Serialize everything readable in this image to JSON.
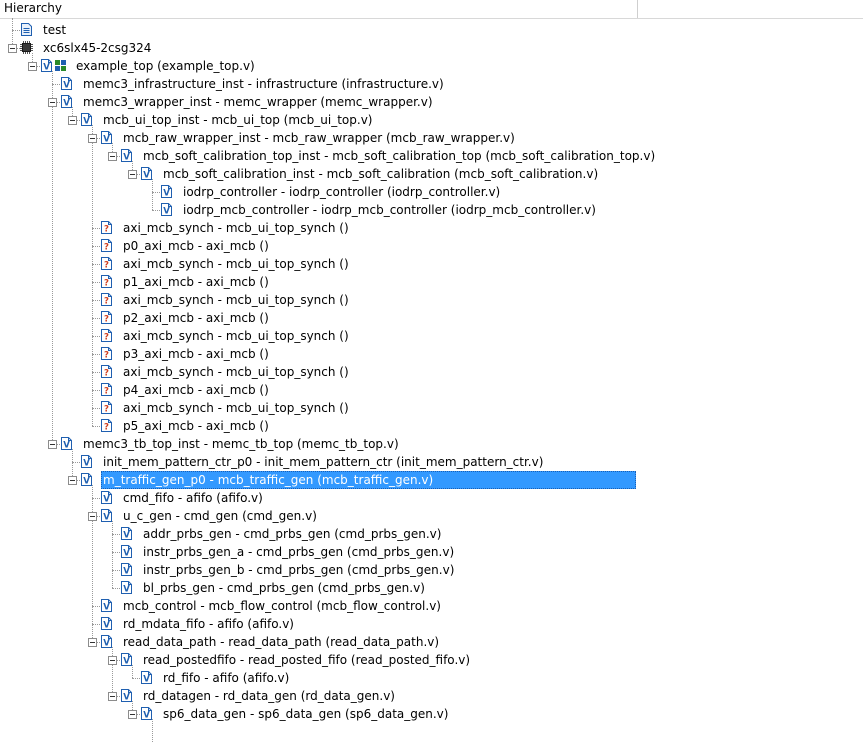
{
  "panel": {
    "title": "Hierarchy"
  },
  "colors": {
    "selection": "#3399ff",
    "verilog_icon": "#1f5fb0",
    "unknown_icon": "#d04020"
  },
  "tree": [
    {
      "label": "test",
      "depth": 0,
      "icon": "text-file-icon",
      "expanded": false,
      "has_children": false
    },
    {
      "label": "xc6slx45-2csg324",
      "depth": 0,
      "icon": "chip-icon",
      "expanded": true,
      "has_children": true
    },
    {
      "label": "example_top (example_top.v)",
      "depth": 1,
      "icon": "verilog-top-module-icon",
      "expanded": true,
      "has_children": true
    },
    {
      "label": "memc3_infrastructure_inst - infrastructure (infrastructure.v)",
      "depth": 2,
      "icon": "verilog-file-icon",
      "expanded": false,
      "has_children": false
    },
    {
      "label": "memc3_wrapper_inst - memc_wrapper (memc_wrapper.v)",
      "depth": 2,
      "icon": "verilog-file-icon",
      "expanded": true,
      "has_children": true
    },
    {
      "label": "mcb_ui_top_inst - mcb_ui_top (mcb_ui_top.v)",
      "depth": 3,
      "icon": "verilog-file-icon",
      "expanded": true,
      "has_children": true
    },
    {
      "label": "mcb_raw_wrapper_inst - mcb_raw_wrapper (mcb_raw_wrapper.v)",
      "depth": 4,
      "icon": "verilog-file-icon",
      "expanded": true,
      "has_children": true
    },
    {
      "label": "mcb_soft_calibration_top_inst - mcb_soft_calibration_top (mcb_soft_calibration_top.v)",
      "depth": 5,
      "icon": "verilog-file-icon",
      "expanded": true,
      "has_children": true
    },
    {
      "label": "mcb_soft_calibration_inst - mcb_soft_calibration (mcb_soft_calibration.v)",
      "depth": 6,
      "icon": "verilog-file-icon",
      "expanded": true,
      "has_children": true
    },
    {
      "label": "iodrp_controller - iodrp_controller (iodrp_controller.v)",
      "depth": 7,
      "icon": "verilog-file-icon",
      "expanded": false,
      "has_children": false
    },
    {
      "label": "iodrp_mcb_controller - iodrp_mcb_controller (iodrp_mcb_controller.v)",
      "depth": 7,
      "icon": "verilog-file-icon",
      "expanded": false,
      "has_children": false
    },
    {
      "label": "axi_mcb_synch - mcb_ui_top_synch ()",
      "depth": 4,
      "icon": "unknown-file-icon",
      "expanded": false,
      "has_children": false
    },
    {
      "label": "p0_axi_mcb - axi_mcb ()",
      "depth": 4,
      "icon": "unknown-file-icon",
      "expanded": false,
      "has_children": false
    },
    {
      "label": "axi_mcb_synch - mcb_ui_top_synch ()",
      "depth": 4,
      "icon": "unknown-file-icon",
      "expanded": false,
      "has_children": false
    },
    {
      "label": "p1_axi_mcb - axi_mcb ()",
      "depth": 4,
      "icon": "unknown-file-icon",
      "expanded": false,
      "has_children": false
    },
    {
      "label": "axi_mcb_synch - mcb_ui_top_synch ()",
      "depth": 4,
      "icon": "unknown-file-icon",
      "expanded": false,
      "has_children": false
    },
    {
      "label": "p2_axi_mcb - axi_mcb ()",
      "depth": 4,
      "icon": "unknown-file-icon",
      "expanded": false,
      "has_children": false
    },
    {
      "label": "axi_mcb_synch - mcb_ui_top_synch ()",
      "depth": 4,
      "icon": "unknown-file-icon",
      "expanded": false,
      "has_children": false
    },
    {
      "label": "p3_axi_mcb - axi_mcb ()",
      "depth": 4,
      "icon": "unknown-file-icon",
      "expanded": false,
      "has_children": false
    },
    {
      "label": "axi_mcb_synch - mcb_ui_top_synch ()",
      "depth": 4,
      "icon": "unknown-file-icon",
      "expanded": false,
      "has_children": false
    },
    {
      "label": "p4_axi_mcb - axi_mcb ()",
      "depth": 4,
      "icon": "unknown-file-icon",
      "expanded": false,
      "has_children": false
    },
    {
      "label": "axi_mcb_synch - mcb_ui_top_synch ()",
      "depth": 4,
      "icon": "unknown-file-icon",
      "expanded": false,
      "has_children": false
    },
    {
      "label": "p5_axi_mcb - axi_mcb ()",
      "depth": 4,
      "icon": "unknown-file-icon",
      "expanded": false,
      "has_children": false
    },
    {
      "label": "memc3_tb_top_inst - memc_tb_top (memc_tb_top.v)",
      "depth": 2,
      "icon": "verilog-file-icon",
      "expanded": true,
      "has_children": true
    },
    {
      "label": "init_mem_pattern_ctr_p0 - init_mem_pattern_ctr (init_mem_pattern_ctr.v)",
      "depth": 3,
      "icon": "verilog-file-icon",
      "expanded": false,
      "has_children": false
    },
    {
      "label": "m_traffic_gen_p0 - mcb_traffic_gen (mcb_traffic_gen.v)",
      "depth": 3,
      "icon": "verilog-file-icon",
      "expanded": true,
      "has_children": true,
      "selected": true
    },
    {
      "label": "cmd_fifo - afifo (afifo.v)",
      "depth": 4,
      "icon": "verilog-file-icon",
      "expanded": false,
      "has_children": false
    },
    {
      "label": "u_c_gen - cmd_gen (cmd_gen.v)",
      "depth": 4,
      "icon": "verilog-file-icon",
      "expanded": true,
      "has_children": true
    },
    {
      "label": "addr_prbs_gen - cmd_prbs_gen (cmd_prbs_gen.v)",
      "depth": 5,
      "icon": "verilog-file-icon",
      "expanded": false,
      "has_children": false
    },
    {
      "label": "instr_prbs_gen_a - cmd_prbs_gen (cmd_prbs_gen.v)",
      "depth": 5,
      "icon": "verilog-file-icon",
      "expanded": false,
      "has_children": false
    },
    {
      "label": "instr_prbs_gen_b - cmd_prbs_gen (cmd_prbs_gen.v)",
      "depth": 5,
      "icon": "verilog-file-icon",
      "expanded": false,
      "has_children": false
    },
    {
      "label": "bl_prbs_gen - cmd_prbs_gen (cmd_prbs_gen.v)",
      "depth": 5,
      "icon": "verilog-file-icon",
      "expanded": false,
      "has_children": false
    },
    {
      "label": "mcb_control - mcb_flow_control (mcb_flow_control.v)",
      "depth": 4,
      "icon": "verilog-file-icon",
      "expanded": false,
      "has_children": false
    },
    {
      "label": "rd_mdata_fifo - afifo (afifo.v)",
      "depth": 4,
      "icon": "verilog-file-icon",
      "expanded": false,
      "has_children": false
    },
    {
      "label": "read_data_path - read_data_path (read_data_path.v)",
      "depth": 4,
      "icon": "verilog-file-icon",
      "expanded": true,
      "has_children": true
    },
    {
      "label": "read_postedfifo - read_posted_fifo (read_posted_fifo.v)",
      "depth": 5,
      "icon": "verilog-file-icon",
      "expanded": true,
      "has_children": true
    },
    {
      "label": "rd_fifo - afifo (afifo.v)",
      "depth": 6,
      "icon": "verilog-file-icon",
      "expanded": false,
      "has_children": false
    },
    {
      "label": "rd_datagen - rd_data_gen (rd_data_gen.v)",
      "depth": 5,
      "icon": "verilog-file-icon",
      "expanded": true,
      "has_children": true
    },
    {
      "label": "sp6_data_gen - sp6_data_gen (sp6_data_gen.v)",
      "depth": 6,
      "icon": "verilog-file-icon",
      "expanded": true,
      "has_children": true
    }
  ]
}
